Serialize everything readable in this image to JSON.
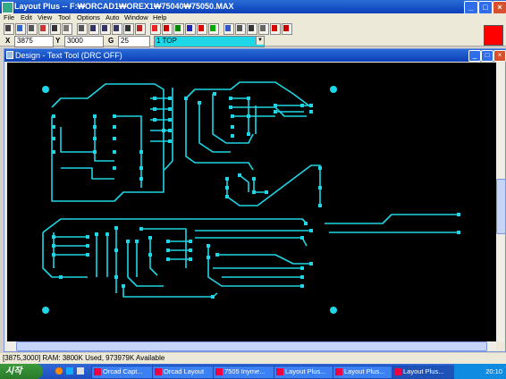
{
  "window": {
    "title": "Layout Plus -- F:₩ORCAD1₩OREX1₩75040₩75050.MAX"
  },
  "window_controls": {
    "minimize": "_",
    "maximize": "□",
    "close": "×"
  },
  "menu": [
    "File",
    "Edit",
    "View",
    "Tool",
    "Options",
    "Auto",
    "Window",
    "Help"
  ],
  "toolbar": {
    "icons": [
      "open-icon",
      "save-icon",
      "print-icon",
      "delete-icon",
      "find-icon",
      "edit-icon",
      "table-icon",
      "zoom-in-icon",
      "zoom-out-icon",
      "zoom-all-icon",
      "query-icon",
      "component-icon",
      "pad-icon",
      "text-icon",
      "connection-icon",
      "drc-icon",
      "color-icon",
      "layer-icon",
      "tool-icon",
      "error-icon",
      "reconnect-icon",
      "help-icon",
      "stop-icon",
      "clear-icon"
    ]
  },
  "coords": {
    "x_label": "X",
    "x_value": "3875",
    "y_label": "Y",
    "y_value": "3000",
    "g_label": "G",
    "g_value": "25",
    "layer_value": "1 TOP"
  },
  "accent": {
    "red_swatch": "#ff0000",
    "trace": "#1fd6e6"
  },
  "child_window": {
    "title": "Design - Text Tool (DRC OFF)"
  },
  "status": {
    "text": "[3875,3000]  RAM: 3800K Used, 973979K Available"
  },
  "taskbar": {
    "start_label": "시작",
    "tasks": [
      "Orcad Capt...",
      "Orcad Layout",
      "7505 Inyme...",
      "Layout Plus...",
      "Layout Plus...",
      "Layout Plus..."
    ],
    "clock": "20:10"
  }
}
